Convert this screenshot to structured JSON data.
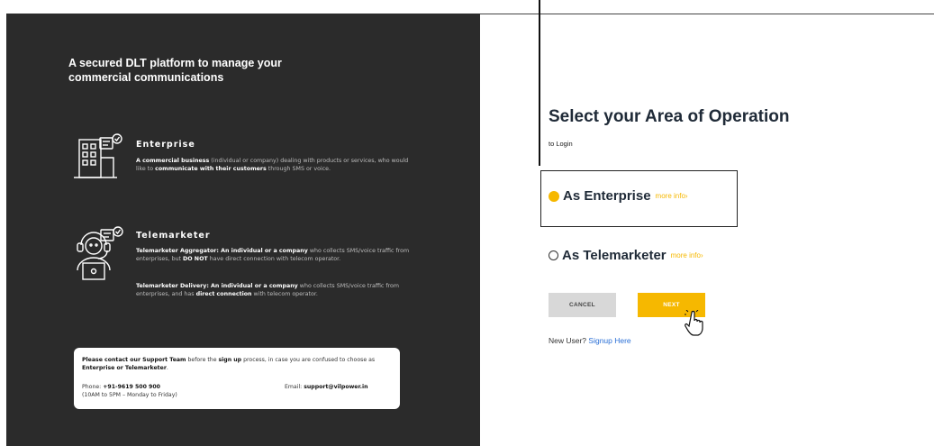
{
  "left": {
    "headline": "A secured DLT platform to manage your commercial communications",
    "enterprise": {
      "icon": "building-chat-icon",
      "title": "Enterprise",
      "desc_bold1": "A commercial business",
      "desc_text1": " (individual or company) dealing with products or services, who would like to ",
      "desc_bold2": "communicate with their customers",
      "desc_text2": " through SMS or voice."
    },
    "telemarketer": {
      "icon": "headset-agent-icon",
      "title": "Telemarketer",
      "agg_bold1": "Telemarketer Aggregator: An individual or a company",
      "agg_text1": " who collects SMS/voice traffic from enterprises, but ",
      "agg_bold2": "DO NOT",
      "agg_text2": " have direct connection with telecom operator.",
      "del_bold1": "Telemarketer Delivery: An individual or a company",
      "del_text1": " who collects SMS/voice traffic from enterprises, and has ",
      "del_bold2": "direct connection",
      "del_text2": " with  telecom operator."
    },
    "support": {
      "bold1": "Please contact our Support Team",
      "text1": " before the ",
      "bold2": "sign up",
      "text2": " process, in case you are confused to choose as ",
      "bold3": "Enterprise or Telemarketer",
      "text3": ".",
      "phone_label": "Phone: ",
      "phone": "+91-9619 500 900",
      "hours": "(10AM to 5PM – Monday to Friday)",
      "email_label": "Email: ",
      "email": "support@vilpower.in"
    }
  },
  "right": {
    "title": "Select your Area of Operation",
    "subtitle": "to Login",
    "options": [
      {
        "label": "As Enterprise",
        "more": "more info›",
        "selected": true
      },
      {
        "label": "As Telemarketer",
        "more": "more info›",
        "selected": false
      }
    ],
    "cancel_label": "CANCEL",
    "next_label": "NEXT",
    "new_user": "New User? ",
    "signup_link": "Signup Here"
  },
  "colors": {
    "accent": "#f6b800",
    "panel": "#2b2b2b",
    "link": "#2a6fd6"
  }
}
